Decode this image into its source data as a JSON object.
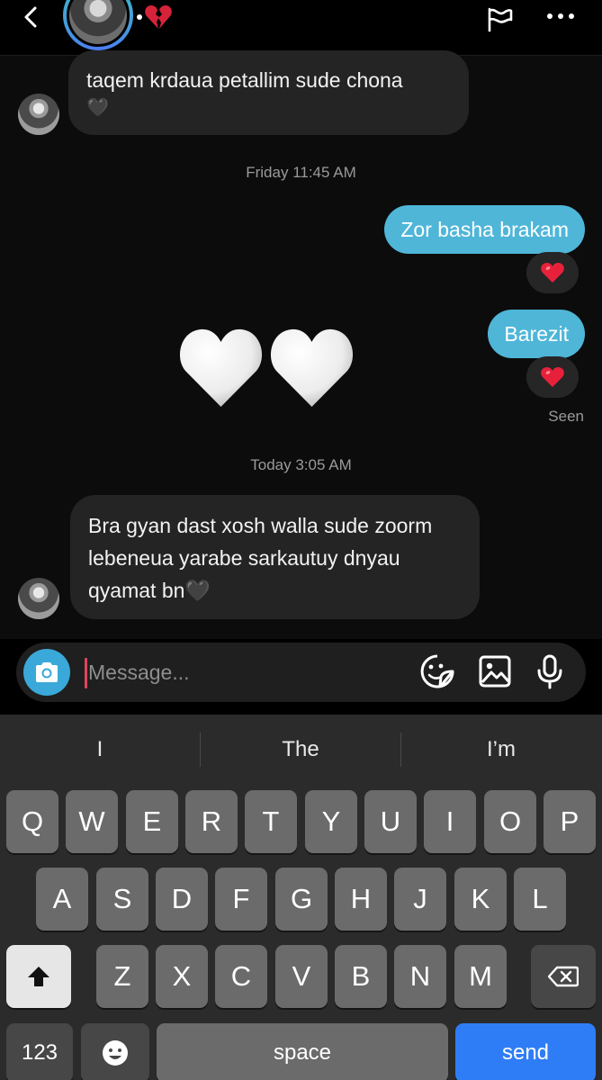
{
  "header": {
    "back_icon": "chevron-left-icon",
    "status_emoji": "broken-heart-icon",
    "actions": [
      "flag-icon",
      "more-icon"
    ]
  },
  "messages": [
    {
      "from": "them",
      "text": "taqem krdaua petallim sude chona",
      "emoji": "🖤"
    },
    {
      "type": "timestamp",
      "text": "Friday 11:45 AM"
    },
    {
      "from": "me",
      "text": "Zor basha brakam",
      "reaction": "❤️"
    },
    {
      "from": "me",
      "text": "Barezit",
      "reaction": "❤️"
    },
    {
      "from": "them",
      "type": "emoji",
      "text": "🤍🤍"
    },
    {
      "type": "seen",
      "text": "Seen"
    },
    {
      "type": "timestamp",
      "text": "Today 3:05 AM"
    },
    {
      "from": "them",
      "text_lines": [
        "Bra gyan dast xosh walla sude zoorm",
        "lebeneua yarabe sarkautuy dnyau",
        "qyamat bn🖤"
      ]
    }
  ],
  "composer": {
    "placeholder": "Message...",
    "value": "",
    "icons": [
      "camera-icon",
      "sticker-icon",
      "gallery-icon",
      "microphone-icon"
    ],
    "accent": "#3aa9d9"
  },
  "keyboard": {
    "suggestions": [
      "I",
      "The",
      "I’m"
    ],
    "row1": [
      "Q",
      "W",
      "E",
      "R",
      "T",
      "Y",
      "U",
      "I",
      "O",
      "P"
    ],
    "row2": [
      "A",
      "S",
      "D",
      "F",
      "G",
      "H",
      "J",
      "K",
      "L"
    ],
    "row3": [
      "Z",
      "X",
      "C",
      "V",
      "B",
      "N",
      "M"
    ],
    "numbers_label": "123",
    "space_label": "space",
    "send_label": "send",
    "send_color": "#2f7df6"
  }
}
